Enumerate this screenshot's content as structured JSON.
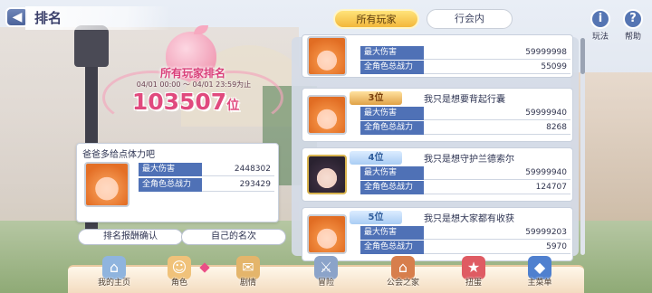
{
  "header": {
    "title": "排名",
    "back_icon": "back-arrow-icon"
  },
  "tabs": [
    {
      "label": "所有玩家",
      "active": true
    },
    {
      "label": "行会内",
      "active": false
    }
  ],
  "corner_buttons": {
    "rules": {
      "label": "玩法",
      "glyph": "i"
    },
    "help": {
      "label": "帮助",
      "glyph": "?"
    }
  },
  "rank_summary": {
    "title": "所有玩家排名",
    "period": "04/01 00:00 ～ 04/01 23:59为止",
    "rank": "103507",
    "unit": "位"
  },
  "my_card": {
    "name": "爸爸多给点体力吧",
    "stats": [
      {
        "label": "最大伤害",
        "value": "2448302"
      },
      {
        "label": "全角色总战力",
        "value": "293429"
      }
    ]
  },
  "buttons": {
    "claim_reward": "排名报酬确认",
    "my_rank": "自己的名次"
  },
  "ranking_list": [
    {
      "rank": "",
      "name": "",
      "damage": "59999998",
      "power": "55099",
      "avatar": "orange"
    },
    {
      "rank": "3位",
      "name": "我只是想要背起行囊",
      "damage": "59999940",
      "power": "8268",
      "avatar": "orange"
    },
    {
      "rank": "4位",
      "name": "我只是想守护兰德索尔",
      "damage": "59999940",
      "power": "124707",
      "avatar": "dark"
    },
    {
      "rank": "5位",
      "name": "我只是想大家都有收获",
      "damage": "59999203",
      "power": "5970",
      "avatar": "orange"
    }
  ],
  "stat_labels": {
    "damage": "最大伤害",
    "power": "全角色总战力"
  },
  "nav": [
    {
      "label": "我的主页",
      "icon": "castle-icon",
      "glyph": "⌂"
    },
    {
      "label": "角色",
      "icon": "character-icon",
      "glyph": "☺"
    },
    {
      "label": "剧情",
      "icon": "scroll-icon",
      "glyph": "✉"
    },
    {
      "label": "冒险",
      "icon": "sword-icon",
      "glyph": "⚔"
    },
    {
      "label": "公会之家",
      "icon": "guild-house-icon",
      "glyph": "⌂"
    },
    {
      "label": "扭蛋",
      "icon": "gacha-icon",
      "glyph": "★"
    },
    {
      "label": "主菜单",
      "icon": "menu-crystal-icon",
      "glyph": "◆"
    }
  ]
}
